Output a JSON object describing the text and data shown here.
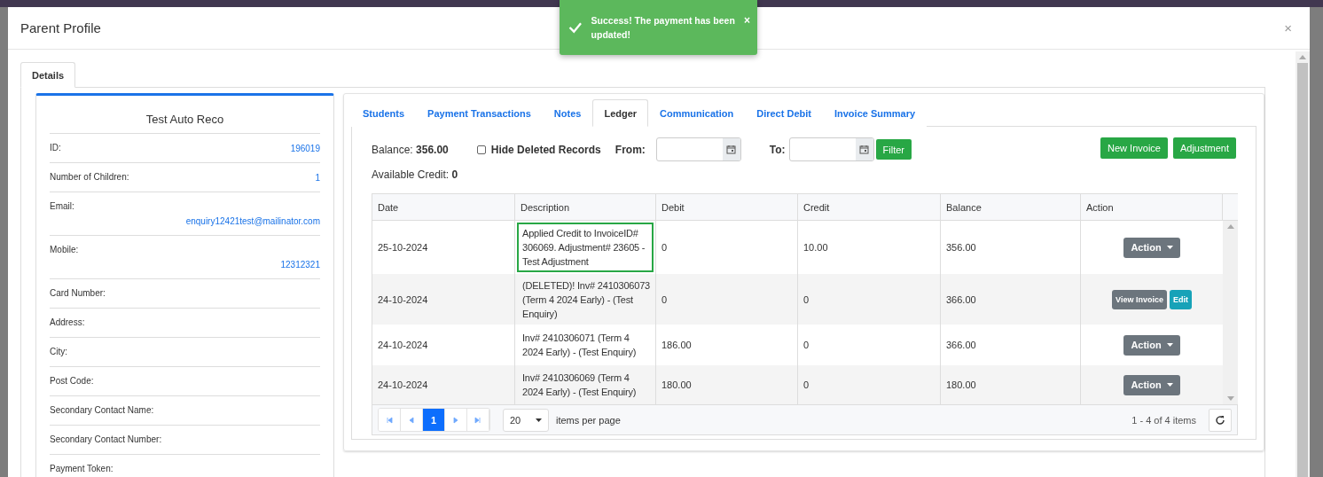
{
  "toast": {
    "message": "Success! The payment has been updated!",
    "close": "×"
  },
  "modal": {
    "title": "Parent Profile",
    "close": "×"
  },
  "outer_tabs": [
    {
      "label": "Details",
      "selected": true
    }
  ],
  "profile": {
    "name": "Test Auto Reco",
    "fields": [
      {
        "label": "ID:",
        "value": "196019",
        "inline": true
      },
      {
        "label": "Number of Children:",
        "value": "1",
        "inline": true
      },
      {
        "label": "Email:",
        "value": "enquiry12421test@mailinator.com",
        "inline": false
      },
      {
        "label": "Mobile:",
        "value": "12312321",
        "inline": false
      },
      {
        "label": "Card Number:"
      },
      {
        "label": "Address:"
      },
      {
        "label": "City:"
      },
      {
        "label": "Post Code:"
      },
      {
        "label": "Secondary Contact Name:"
      },
      {
        "label": "Secondary Contact Number:"
      },
      {
        "label": "Payment Token:"
      }
    ]
  },
  "inner_tabs": [
    {
      "label": "Students",
      "selected": false
    },
    {
      "label": "Payment Transactions",
      "selected": false
    },
    {
      "label": "Notes",
      "selected": false
    },
    {
      "label": "Ledger",
      "selected": true
    },
    {
      "label": "Communication",
      "selected": false
    },
    {
      "label": "Direct Debit",
      "selected": false
    },
    {
      "label": "Invoice Summary",
      "selected": false
    }
  ],
  "ledger": {
    "balance": "Balance: **356.00**",
    "available_credit": "Available Credit: **0**",
    "hide_deleted": {
      "label": "Hide Deleted Records",
      "checked": false
    },
    "from_label": "From:",
    "to_label": "To:",
    "filter_button": "Filter",
    "buttons": [
      "New Invoice",
      "Adjustment"
    ]
  },
  "table": {
    "columns": [
      "Date",
      "Description",
      "Debit",
      "Credit",
      "Balance",
      "Action"
    ],
    "rows": [
      {
        "date": "25-10-2024",
        "description": "Applied Credit to InvoiceID# 306069. Adjustment# 23605 - Test Adjustment",
        "debit": "0",
        "credit": "10.00",
        "balance": "356.00",
        "highlighted": true,
        "actions": [
          {
            "kind": "dropdown",
            "label": "Action"
          }
        ]
      },
      {
        "date": "24-10-2024",
        "description": "(DELETED)! Inv# 2410306073 (Term 4 2024 Early) - (Test Enquiry)",
        "debit": "0",
        "credit": "0",
        "balance": "366.00",
        "highlighted": false,
        "actions": [
          {
            "kind": "secondary",
            "label": "View Invoice"
          },
          {
            "kind": "info",
            "label": "Edit"
          }
        ]
      },
      {
        "date": "24-10-2024",
        "description": "Inv# 2410306071 (Term 4 2024 Early) - (Test Enquiry)",
        "debit": "186.00",
        "credit": "0",
        "balance": "366.00",
        "highlighted": false,
        "actions": [
          {
            "kind": "dropdown",
            "label": "Action"
          }
        ]
      },
      {
        "date": "24-10-2024",
        "description": "Inv# 2410306069 (Term 4 2024 Early) - (Test Enquiry)",
        "debit": "180.00",
        "credit": "0",
        "balance": "180.00",
        "highlighted": false,
        "actions": [
          {
            "kind": "dropdown",
            "label": "Action"
          }
        ]
      }
    ]
  },
  "pager": {
    "pages": [
      {
        "label": "1",
        "selected": true
      }
    ],
    "page_size": "20",
    "page_size_label": "items per page",
    "summary": "1 - 4 of 4 items"
  }
}
